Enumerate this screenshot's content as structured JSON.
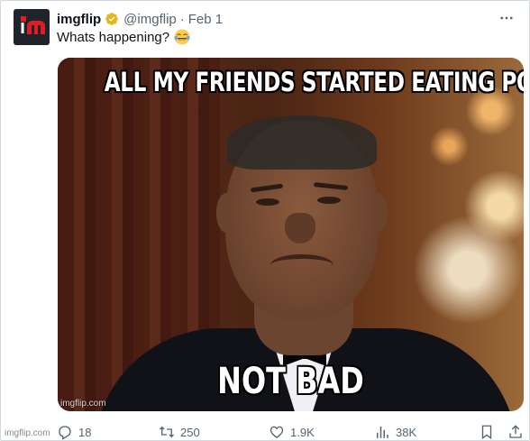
{
  "author": {
    "name": "imgflip",
    "handle": "@imgflip",
    "separator": "·",
    "date": "Feb 1",
    "avatar_icon": "imgflip-logo-icon",
    "verified_icon": "verified-badge-icon",
    "brand_colors": {
      "logo_bg": "#1f232b",
      "logo_red": "#e01c24",
      "verified_gold": "#e2b719"
    }
  },
  "tweet": {
    "text": "Whats happening?",
    "emoji_icon": "face-with-tears-of-joy-icon"
  },
  "media": {
    "top_text": "ALL MY FRIENDS STARTED EATING POOP",
    "bottom_text": "NOT BAD",
    "watermark": "imgflip.com"
  },
  "actions": {
    "reply_count": "18",
    "retweet_count": "250",
    "like_count": "1.9K",
    "views_count": "38K"
  },
  "footer": {
    "watermark": "imgflip.com"
  },
  "colors": {
    "text_primary": "#0f1419",
    "text_secondary": "#536471",
    "border": "#cfd9de"
  }
}
